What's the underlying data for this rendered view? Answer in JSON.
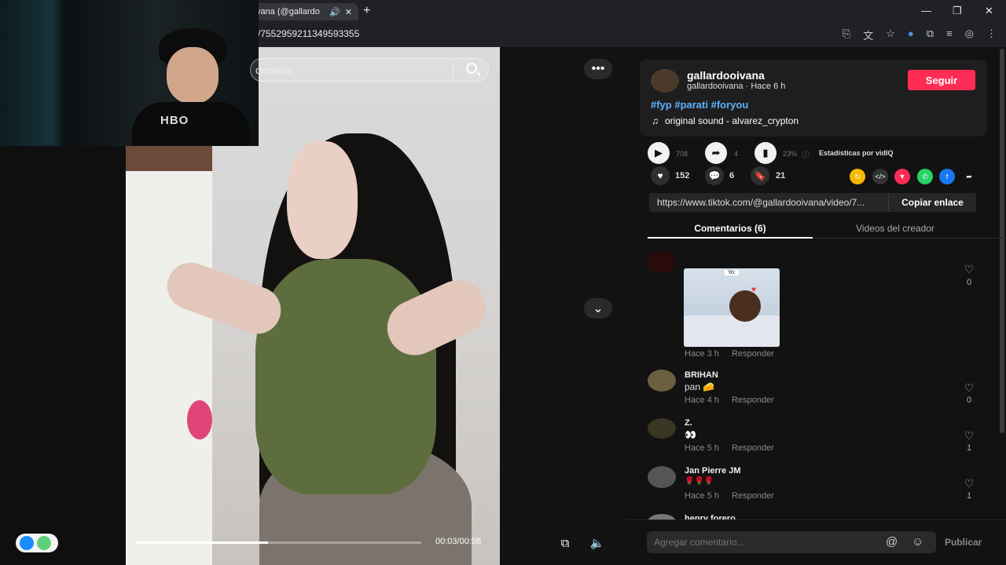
{
  "browser": {
    "tab_title": "vana (@gallardo",
    "tab_audio_icon": "speaker-icon",
    "new_tab": "+",
    "address": "/7552959211349593355",
    "window_buttons": [
      "—",
      "❐",
      "✕"
    ]
  },
  "video": {
    "search_placeholder": "cionado",
    "time": "00:03/00:08",
    "progress_fraction": 0.46
  },
  "creator": {
    "name": "gallardooivana",
    "subline": "gallardooivana · Hace 6 h",
    "follow_label": "Seguir",
    "hashtags": "#fyp #parati #foryou",
    "sound": "original sound - alvarez_crypton"
  },
  "stats": {
    "plays": "708",
    "shares_count": "4",
    "engagement": "23%",
    "vidiq_label": "Estadísticas por vidIQ"
  },
  "actions": {
    "likes": "152",
    "comments": "6",
    "saves": "21"
  },
  "link": {
    "url": "https://www.tiktok.com/@gallardooivana/video/7...",
    "copy_label": "Copiar enlace"
  },
  "tabs": {
    "comments": "Comentarios (6)",
    "creator_videos": "Videos del creador"
  },
  "comments": [
    {
      "name": "",
      "text": "",
      "time": "Hace 3 h",
      "reply": "Responder",
      "likes": "0",
      "gif_caption": "Yo:"
    },
    {
      "name": "BRIHAN",
      "text": "pan 🧀",
      "time": "Hace 4 h",
      "reply": "Responder",
      "likes": "0"
    },
    {
      "name": "Z.",
      "text": "👀",
      "time": "Hace 5 h",
      "reply": "Responder",
      "likes": "1"
    },
    {
      "name": "Jan Pierre JM",
      "text": "🌹🌹🌹",
      "time": "Hace 5 h",
      "reply": "Responder",
      "likes": "1"
    },
    {
      "name": "henry forero"
    }
  ],
  "compose": {
    "placeholder": "Agregar comentario...",
    "publish_label": "Publicar"
  },
  "colors": {
    "accent": "#fe2c55",
    "hashtag": "#5cb3ff",
    "panel_bg": "#121212"
  }
}
